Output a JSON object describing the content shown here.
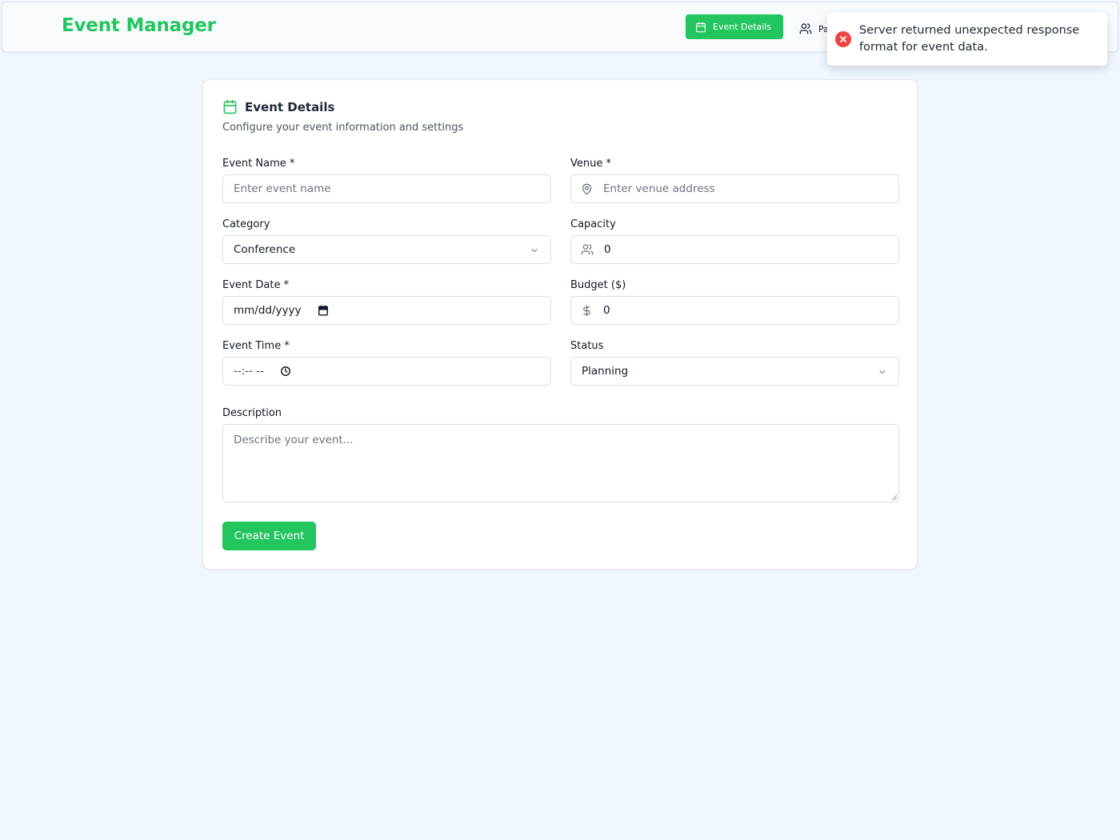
{
  "header": {
    "app_title": "Event Manager",
    "nav": [
      {
        "label": "Event Details",
        "icon": "calendar-icon",
        "active": true
      },
      {
        "label": "Pa",
        "icon": "users-icon",
        "active": false
      }
    ]
  },
  "toast": {
    "type": "error",
    "icon": "error-x-icon",
    "message": "Server returned unexpected response format for event data."
  },
  "card": {
    "icon": "calendar-icon",
    "title": "Event Details",
    "subtitle": "Configure your event information and settings"
  },
  "form": {
    "event_name": {
      "label": "Event Name *",
      "placeholder": "Enter event name",
      "value": ""
    },
    "venue": {
      "label": "Venue *",
      "placeholder": "Enter venue address",
      "value": "",
      "icon": "map-pin-icon"
    },
    "category": {
      "label": "Category",
      "selected": "Conference"
    },
    "capacity": {
      "label": "Capacity",
      "value": "0",
      "icon": "users-icon"
    },
    "event_date": {
      "label": "Event Date *",
      "placeholder": "mm/dd/yyyy",
      "icon": "calendar-icon"
    },
    "budget": {
      "label": "Budget ($)",
      "value": "0",
      "icon": "dollar-icon"
    },
    "event_time": {
      "label": "Event Time *",
      "placeholder": "--:-- --",
      "icon": "clock-icon"
    },
    "status": {
      "label": "Status",
      "selected": "Planning"
    },
    "description": {
      "label": "Description",
      "placeholder": "Describe your event..."
    },
    "submit_label": "Create Event"
  },
  "colors": {
    "accent": "#22c55e",
    "page_bg": "#eff6fe",
    "error": "#ef4444"
  }
}
